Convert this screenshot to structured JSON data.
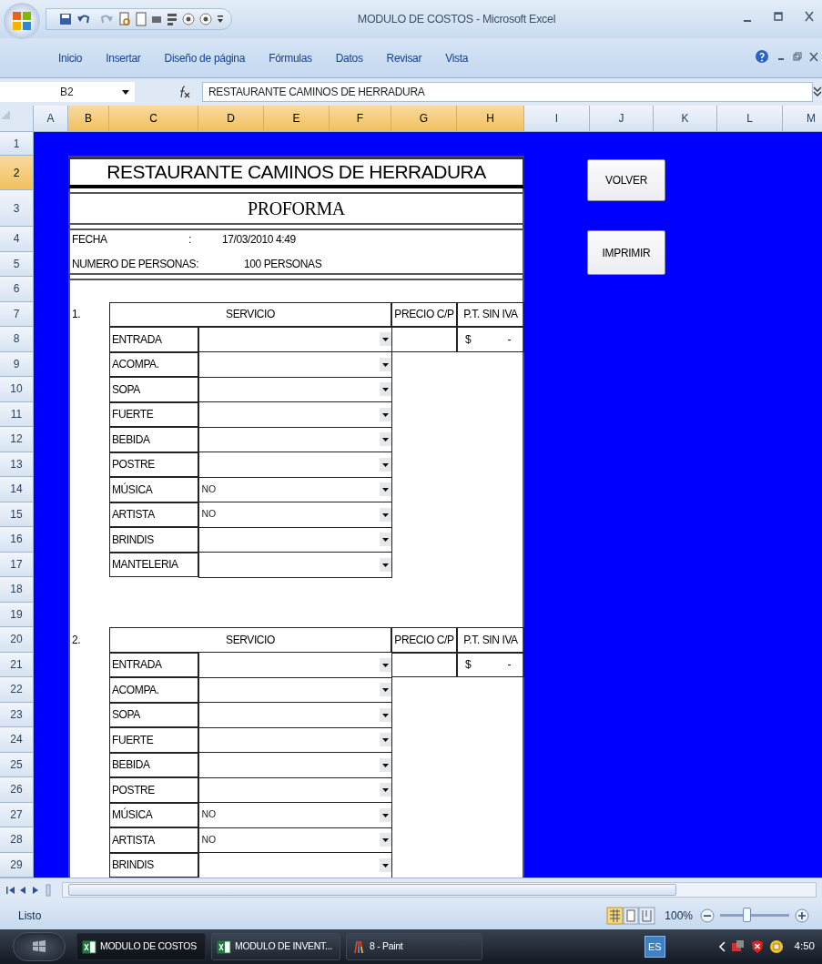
{
  "window": {
    "title": "MODULO DE COSTOS - Microsoft Excel"
  },
  "ribbon_tabs": [
    {
      "label": "Inicio"
    },
    {
      "label": "Insertar"
    },
    {
      "label": "Diseño de página"
    },
    {
      "label": "Fórmulas"
    },
    {
      "label": "Datos"
    },
    {
      "label": "Revisar"
    },
    {
      "label": "Vista"
    }
  ],
  "formula_bar": {
    "name_box": "B2",
    "formula": "RESTAURANTE CAMINOS DE HERRADURA"
  },
  "columns": [
    {
      "label": "A",
      "selected": false
    },
    {
      "label": "B",
      "selected": true
    },
    {
      "label": "C",
      "selected": true
    },
    {
      "label": "D",
      "selected": true
    },
    {
      "label": "E",
      "selected": true
    },
    {
      "label": "F",
      "selected": true
    },
    {
      "label": "G",
      "selected": true
    },
    {
      "label": "H",
      "selected": true
    },
    {
      "label": "I",
      "selected": false
    },
    {
      "label": "J",
      "selected": false
    },
    {
      "label": "K",
      "selected": false
    },
    {
      "label": "L",
      "selected": false
    },
    {
      "label": "M",
      "selected": false
    }
  ],
  "rows": [
    {
      "label": "1",
      "selected": false
    },
    {
      "label": "2",
      "selected": true
    },
    {
      "label": "3",
      "selected": false
    },
    {
      "label": "4",
      "selected": false
    },
    {
      "label": "5",
      "selected": false
    },
    {
      "label": "6",
      "selected": false
    },
    {
      "label": "7",
      "selected": false
    },
    {
      "label": "8",
      "selected": false
    },
    {
      "label": "9",
      "selected": false
    },
    {
      "label": "10",
      "selected": false
    },
    {
      "label": "11",
      "selected": false
    },
    {
      "label": "12",
      "selected": false
    },
    {
      "label": "13",
      "selected": false
    },
    {
      "label": "14",
      "selected": false
    },
    {
      "label": "15",
      "selected": false
    },
    {
      "label": "16",
      "selected": false
    },
    {
      "label": "17",
      "selected": false
    },
    {
      "label": "18",
      "selected": false
    },
    {
      "label": "19",
      "selected": false
    },
    {
      "label": "20",
      "selected": false
    },
    {
      "label": "21",
      "selected": false
    },
    {
      "label": "22",
      "selected": false
    },
    {
      "label": "23",
      "selected": false
    },
    {
      "label": "24",
      "selected": false
    },
    {
      "label": "25",
      "selected": false
    },
    {
      "label": "26",
      "selected": false
    },
    {
      "label": "27",
      "selected": false
    },
    {
      "label": "28",
      "selected": false
    },
    {
      "label": "29",
      "selected": false
    }
  ],
  "sheet": {
    "title": "RESTAURANTE CAMINOS DE HERRADURA",
    "subtitle": "PROFORMA",
    "date_label": "FECHA",
    "date_colon": ":",
    "date_value": "17/03/2010 4:49",
    "people_label": "NUMERO DE PERSONAS:",
    "people_value": "100 PERSONAS"
  },
  "sections": [
    {
      "number": "1.",
      "header": "SERVICIO",
      "price_header": "PRECIO C/P",
      "total_header": "P.T. SIN IVA",
      "currency": "$",
      "total": "-",
      "items": [
        {
          "label": "ENTRADA"
        },
        {
          "label": "ACOMPA."
        },
        {
          "label": "SOPA"
        },
        {
          "label": "FUERTE"
        },
        {
          "label": "BEBIDA"
        },
        {
          "label": "POSTRE"
        },
        {
          "label": "MÚSICA",
          "value": "NO"
        },
        {
          "label": "ARTISTA",
          "value": "NO"
        },
        {
          "label": "BRINDIS"
        },
        {
          "label": "MANTELERIA"
        }
      ]
    },
    {
      "number": "2.",
      "header": "SERVICIO",
      "price_header": "PRECIO C/P",
      "total_header": "P.T. SIN IVA",
      "currency": "$",
      "total": "-",
      "items": [
        {
          "label": "ENTRADA"
        },
        {
          "label": "ACOMPA."
        },
        {
          "label": "SOPA"
        },
        {
          "label": "FUERTE"
        },
        {
          "label": "BEBIDA"
        },
        {
          "label": "POSTRE"
        },
        {
          "label": "MÚSICA",
          "value": "NO"
        },
        {
          "label": "ARTISTA",
          "value": "NO"
        },
        {
          "label": "BRINDIS"
        }
      ]
    }
  ],
  "buttons": [
    {
      "label": "VOLVER"
    },
    {
      "label": "IMPRIMIR"
    }
  ],
  "status_bar": {
    "status": "Listo",
    "zoom": "100%",
    "zoom_level": {
      "level": 0.4
    }
  },
  "taskbar": {
    "items": [
      {
        "label": "MODULO DE COSTOS",
        "selected": true,
        "kind": "excel"
      },
      {
        "label": "MODULO DE INVENT...",
        "selected": false,
        "kind": "excel"
      },
      {
        "label": "8 - Paint",
        "selected": false,
        "kind": "paint"
      }
    ],
    "language": "ES",
    "clock": "4:50"
  }
}
